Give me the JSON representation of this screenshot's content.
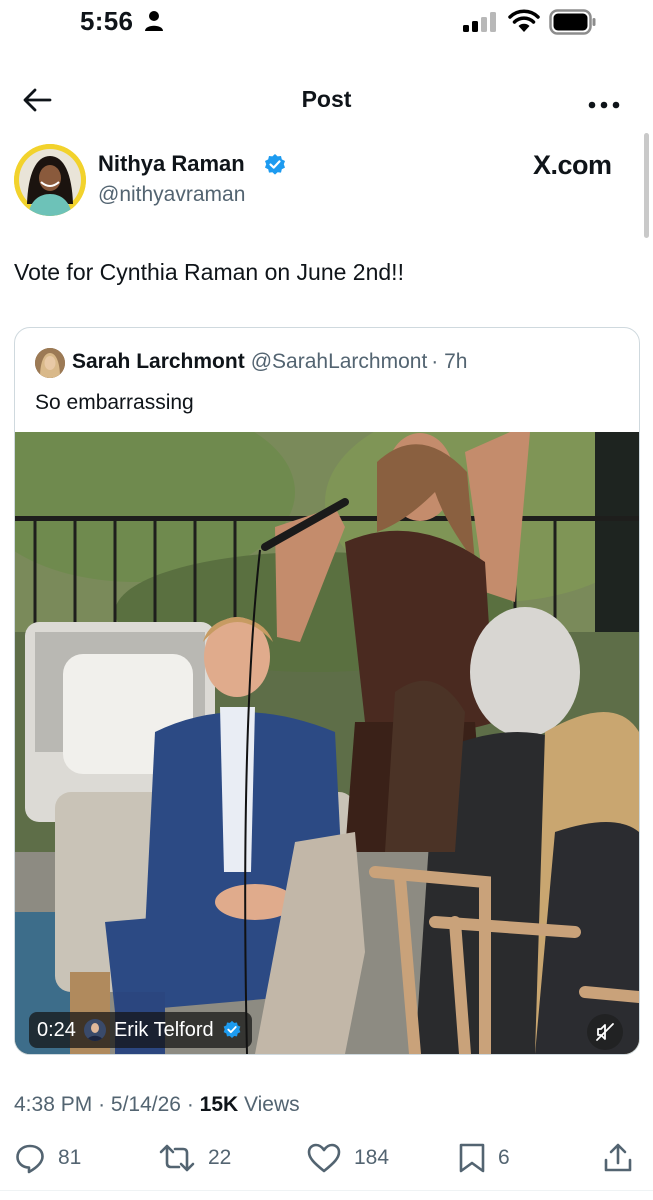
{
  "status_bar": {
    "time": "5:56"
  },
  "header": {
    "title": "Post"
  },
  "post": {
    "author_name": "Nithya Raman",
    "author_handle": "@nithyavraman",
    "source_label": "X.com",
    "text": "Vote for Cynthia Raman on June 2nd!!"
  },
  "quote": {
    "author_name": "Sarah Larchmont",
    "author_handle": "@SarahLarchmont",
    "time": "· 7h",
    "text": "So embarrassing",
    "video": {
      "duration": "0:24",
      "uploader": "Erik Telford"
    }
  },
  "meta": {
    "time": "4:38 PM",
    "date": "5/14/26",
    "views_count": "15K",
    "views_label": "Views"
  },
  "actions": {
    "replies": "81",
    "reposts": "22",
    "likes": "184",
    "bookmarks": "6"
  },
  "colors": {
    "verified": "#1d9bf0",
    "secondary_text": "#536471",
    "avatar_ring": "#f2d22c"
  }
}
